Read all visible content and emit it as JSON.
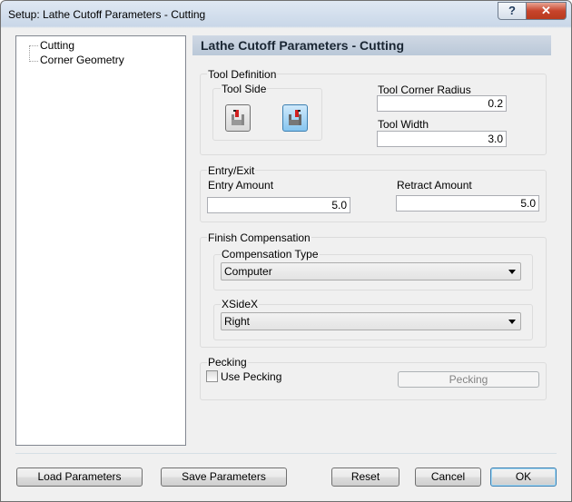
{
  "window": {
    "title": "Setup: Lathe Cutoff Parameters - Cutting",
    "help_label": "?",
    "close_label": "✕"
  },
  "tree": {
    "items": [
      {
        "label": "Cutting"
      },
      {
        "label": "Corner Geometry"
      }
    ]
  },
  "header": {
    "title": "Lathe Cutoff Parameters - Cutting"
  },
  "tool_definition": {
    "label": "Tool Definition",
    "tool_side_label": "Tool Side",
    "selected_side": "right",
    "corner_radius_label": "Tool Corner Radius",
    "corner_radius_value": "0.2",
    "tool_width_label": "Tool Width",
    "tool_width_value": "3.0"
  },
  "entry_exit": {
    "label": "Entry/Exit",
    "entry_label": "Entry Amount",
    "entry_value": "5.0",
    "retract_label": "Retract Amount",
    "retract_value": "5.0"
  },
  "finish_comp": {
    "label": "Finish Compensation",
    "comp_type_label": "Compensation Type",
    "comp_type_value": "Computer",
    "xsidex_label": "XSideX",
    "xsidex_value": "Right"
  },
  "pecking": {
    "label": "Pecking",
    "use_label": "Use Pecking",
    "use_checked": false,
    "button_label": "Pecking"
  },
  "footer": {
    "load": "Load Parameters",
    "save": "Save Parameters",
    "reset": "Reset",
    "cancel": "Cancel",
    "ok": "OK"
  },
  "colors": {
    "header_bg": "#c4cfdd",
    "selected_tool": "#86c5ef",
    "close_red": "#c7442c"
  }
}
